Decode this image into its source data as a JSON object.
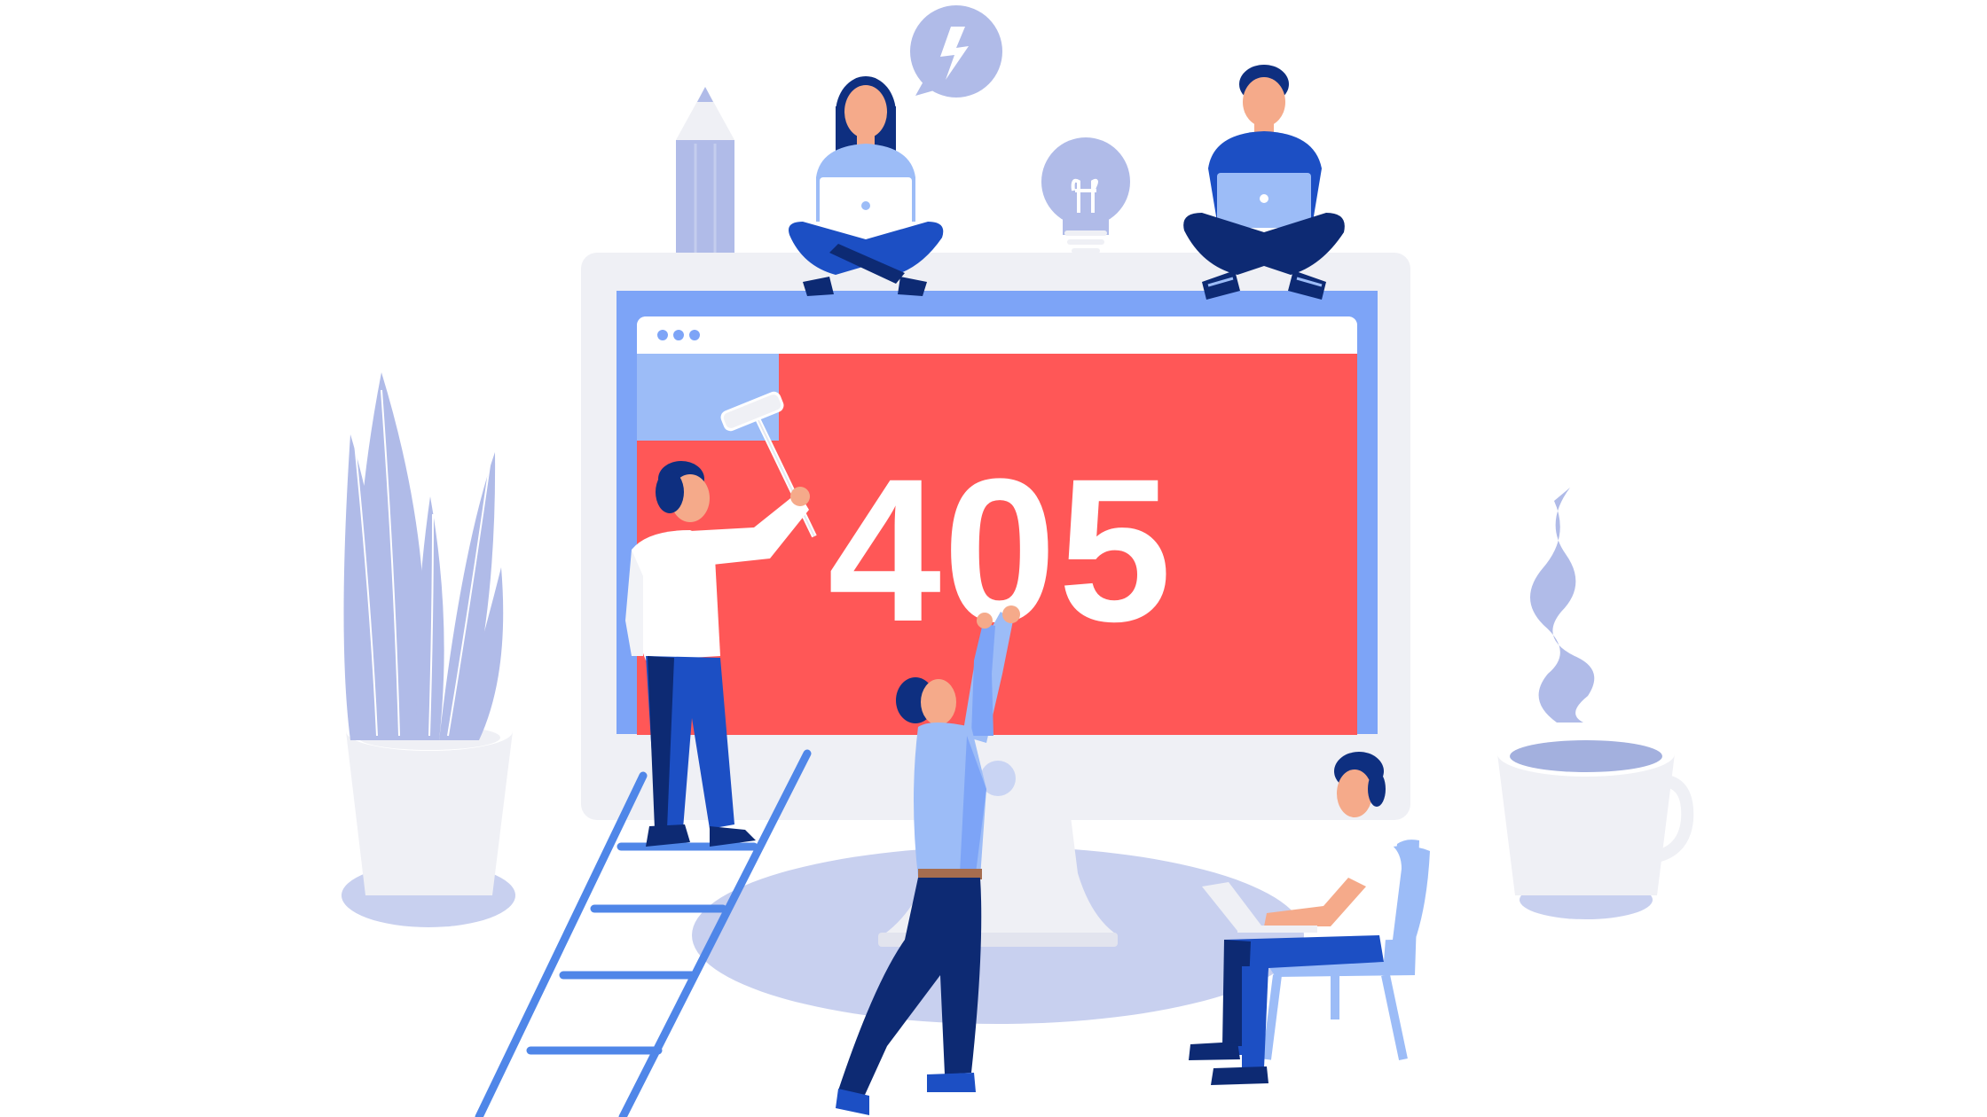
{
  "error": {
    "code": "405"
  },
  "palette": {
    "screen_red": "#ff5757",
    "monitor_frame": "#eff0f5",
    "monitor_bezel": "#7da4f7",
    "accent_light": "#b0bbe8",
    "navy": "#0d2a73",
    "denim": "#1c4fc4",
    "sky": "#9cbcf7",
    "skin": "#f5aa8a",
    "hair": "#0e2f80",
    "white": "#ffffff"
  },
  "icons": {
    "speech_bubble": "lightning-speech-bubble-icon",
    "bulb": "lightbulb-icon",
    "pencil": "pencil-icon",
    "plant": "plant-icon",
    "cup": "coffee-cup-icon",
    "ladder": "ladder-icon",
    "laptop": "laptop-icon"
  }
}
